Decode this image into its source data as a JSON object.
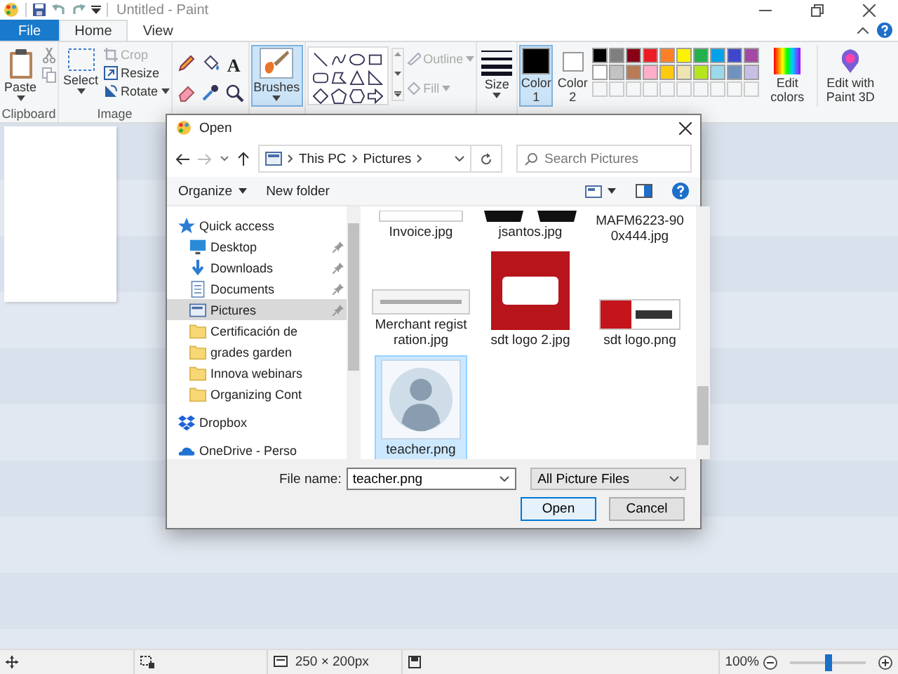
{
  "window": {
    "title": "Untitled - Paint"
  },
  "tabs": [
    {
      "label": "File",
      "kind": "file",
      "selected": false
    },
    {
      "label": "Home",
      "kind": "tab",
      "selected": true
    },
    {
      "label": "View",
      "kind": "tab",
      "selected": false
    }
  ],
  "ribbon": {
    "clipboard": {
      "label": "Clipboard",
      "paste": "Paste"
    },
    "image": {
      "label": "Image",
      "select": "Select",
      "commands": [
        {
          "label": "Crop",
          "kind": "crop",
          "disabled": true
        },
        {
          "label": "Resize",
          "kind": "resize",
          "disabled": false
        },
        {
          "label": "Rotate",
          "kind": "rotate",
          "disabled": false
        }
      ]
    },
    "tools": {
      "text_tool": "A"
    },
    "brushes": {
      "label": "Brushes",
      "selected": true
    },
    "shape_options": [
      {
        "label": "Outline",
        "kind": "outline",
        "disabled": true
      },
      {
        "label": "Fill",
        "kind": "fill",
        "disabled": true
      }
    ],
    "size": {
      "label": "Size"
    },
    "color_slots": [
      {
        "label": "Color 1",
        "color": "#000000",
        "selected": true
      },
      {
        "label": "Color 2",
        "color": "#ffffff",
        "selected": false
      }
    ],
    "palette": [
      {
        "color": "#000000"
      },
      {
        "color": "#7f7f7f"
      },
      {
        "color": "#880015"
      },
      {
        "color": "#ed1c24"
      },
      {
        "color": "#ff7f27"
      },
      {
        "color": "#fff200"
      },
      {
        "color": "#22b14c"
      },
      {
        "color": "#00a2e8"
      },
      {
        "color": "#3f48cc"
      },
      {
        "color": "#a349a4"
      },
      {
        "color": "#ffffff"
      },
      {
        "color": "#c3c3c3"
      },
      {
        "color": "#b97a57"
      },
      {
        "color": "#ffaec9"
      },
      {
        "color": "#ffc90e"
      },
      {
        "color": "#efe4b0"
      },
      {
        "color": "#b5e61d"
      },
      {
        "color": "#99d9ea"
      },
      {
        "color": "#7092be"
      },
      {
        "color": "#c8bfe7"
      }
    ],
    "edit_colors": {
      "label": "Edit colors"
    },
    "paint3d": {
      "label": "Edit with Paint 3D"
    }
  },
  "status_bar": {
    "canvas_size": "250 × 200px",
    "zoom": {
      "reading": "100%",
      "level": 0.5
    }
  },
  "dialog": {
    "title": "Open",
    "path": [
      "This PC",
      "Pictures"
    ],
    "search": {
      "placeholder": "Search Pictures"
    },
    "toolbar": {
      "organize": "Organize",
      "new_folder": "New folder"
    },
    "nav": [
      {
        "label": "Quick access",
        "kind": "quick",
        "pinned": false,
        "selected": false,
        "children": [
          {
            "label": "Desktop",
            "kind": "desktop",
            "pinned": true,
            "selected": false
          },
          {
            "label": "Downloads",
            "kind": "downloads",
            "pinned": true,
            "selected": false
          },
          {
            "label": "Documents",
            "kind": "documents",
            "pinned": true,
            "selected": false
          },
          {
            "label": "Pictures",
            "kind": "pictures",
            "pinned": true,
            "selected": true
          },
          {
            "label": "Certificación de",
            "kind": "folder",
            "pinned": false,
            "selected": false
          },
          {
            "label": "grades garden",
            "kind": "folder",
            "pinned": false,
            "selected": false
          },
          {
            "label": "Innova webinars",
            "kind": "folder",
            "pinned": false,
            "selected": false
          },
          {
            "label": "Organizing Cont",
            "kind": "folder",
            "pinned": false,
            "selected": false
          }
        ]
      },
      {
        "label": "Dropbox",
        "kind": "dropbox",
        "pinned": false,
        "selected": false
      },
      {
        "label": "OneDrive - Perso",
        "kind": "onedrive",
        "pinned": false,
        "selected": false
      }
    ],
    "files": [
      {
        "name": "Invoice.jpg",
        "kind": "document",
        "selected": false
      },
      {
        "name": "jsantos.jpg",
        "kind": "dark-photo",
        "selected": false
      },
      {
        "name": "MAFM6223-900x444.jpg",
        "kind": "photo",
        "selected": false
      },
      {
        "name": "Merchant registration.jpg",
        "kind": "banner",
        "selected": false
      },
      {
        "name": "sdt logo 2.jpg",
        "kind": "red-logo",
        "selected": false
      },
      {
        "name": "sdt logo.png",
        "kind": "wide-logo",
        "selected": false
      },
      {
        "name": "teacher.png",
        "kind": "avatar",
        "selected": true
      }
    ],
    "file_name": {
      "label": "File name:",
      "value": "teacher.png"
    },
    "file_type": "All Picture Files",
    "buttons": [
      {
        "label": "Open",
        "kind": "primary"
      },
      {
        "label": "Cancel",
        "kind": "normal"
      }
    ]
  }
}
